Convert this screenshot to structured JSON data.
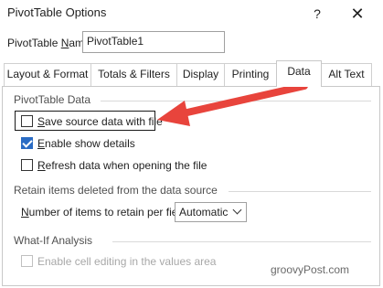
{
  "window": {
    "title": "PivotTable Options",
    "help": "?",
    "close": "✕"
  },
  "name_field": {
    "label_pre": "PivotTable ",
    "label_ul": "N",
    "label_post": "ame:",
    "value": "PivotTable1"
  },
  "tabs": [
    {
      "label": "Layout & Format"
    },
    {
      "label": "Totals & Filters"
    },
    {
      "label": "Display"
    },
    {
      "label": "Printing"
    },
    {
      "label": "Data",
      "active": true
    },
    {
      "label": "Alt Text"
    }
  ],
  "data_tab": {
    "section_pivot": "PivotTable Data",
    "save_source": {
      "ul": "S",
      "rest": "ave source data with file",
      "checked": false
    },
    "enable_details": {
      "ul": "E",
      "rest": "nable show details",
      "checked": true
    },
    "refresh_open": {
      "ul": "R",
      "rest": "efresh data when opening the file",
      "checked": false
    },
    "section_retain": "Retain items deleted from the data source",
    "retain_label_ul": "N",
    "retain_label_rest": "umber of items to retain per field:",
    "retain_value": "Automatic",
    "section_whatif": "What-If Analysis",
    "enable_editing": {
      "label": "Enable cell editing in the values area",
      "checked": false,
      "disabled": true
    }
  },
  "watermark": "groovyPost.com",
  "colors": {
    "arrow": "#e8443c",
    "checkbox_checked": "#2b6cc4"
  },
  "icons": {
    "help": "question-mark-icon",
    "close": "close-icon",
    "arrow": "arrow-annotation-icon",
    "dropdown": "chevron-down-icon"
  }
}
